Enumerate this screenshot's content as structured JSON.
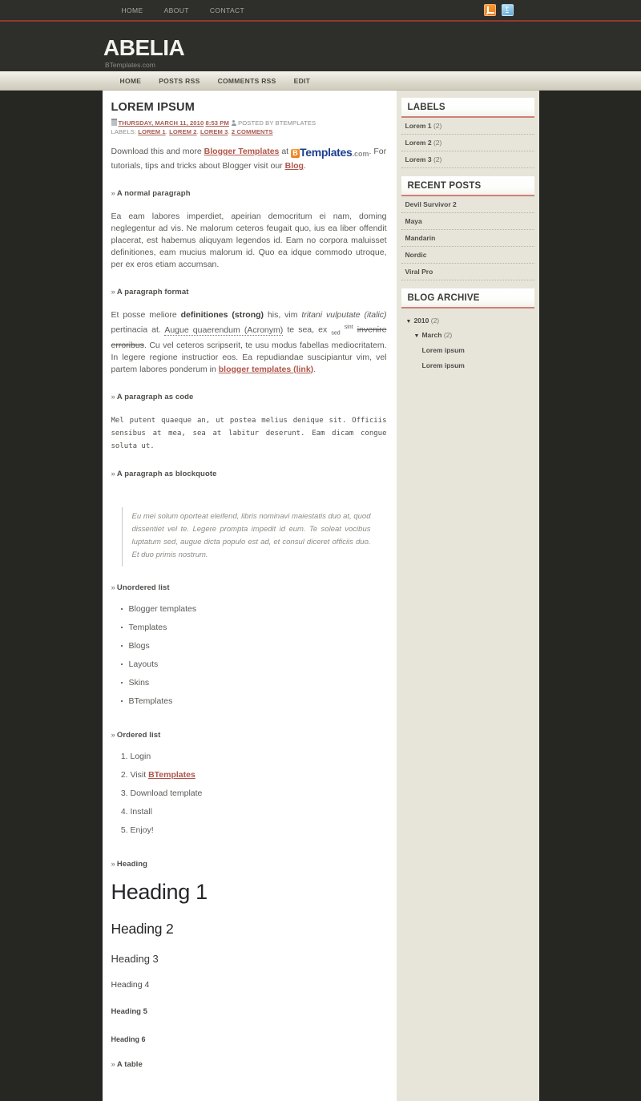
{
  "topbar": {
    "nav": [
      {
        "label": "HOME"
      },
      {
        "label": "ABOUT"
      },
      {
        "label": "CONTACT"
      }
    ],
    "social": [
      {
        "name": "rss-icon",
        "glyph": ""
      },
      {
        "name": "twitter-icon",
        "glyph": "t"
      }
    ]
  },
  "header": {
    "title": "ABELIA",
    "description": "BTemplates.com"
  },
  "menubar": {
    "nav": [
      {
        "label": "HOME"
      },
      {
        "label": "POSTS RSS"
      },
      {
        "label": "COMMENTS RSS"
      },
      {
        "label": "EDIT"
      }
    ]
  },
  "post": {
    "title": "LOREM IPSUM",
    "date": "THURSDAY, MARCH 11, 2010",
    "time": "8:53 PM",
    "author_text": "POSTED BY BTEMPLATES",
    "labels_prefix": "LABELS:",
    "labels": [
      "LOREM 1",
      "LOREM 2",
      "LOREM 3"
    ],
    "label_sep": ".",
    "comments": "2 COMMENTS",
    "intro": {
      "part1": "Download this and more ",
      "link1": "Blogger Templates",
      "part2": " at ",
      "logo_b": "B",
      "logo_word": "Templates",
      "logo_com": ".com",
      "part3": ". For tutorials, tips and tricks about Blogger visit our ",
      "link2": "Blog",
      "part4": "."
    },
    "sections": {
      "normal_paragraph": "A normal paragraph",
      "paragraph_format": "A paragraph format",
      "paragraph_code": "A paragraph as code",
      "paragraph_blockquote": "A paragraph as blockquote",
      "unordered_list": "Unordered list",
      "ordered_list": "Ordered list",
      "heading": "Heading",
      "table": "A table"
    },
    "normal_text": "Ea eam labores imperdiet, apeirian democritum ei nam, doming neglegentur ad vis. Ne malorum ceteros feugait quo, ius ea liber offendit placerat, est habemus aliquyam legendos id. Eam no corpora maluisset definitiones, eam mucius malorum id. Quo ea idque commodo utroque, per ex eros etiam accumsan.",
    "format_text": {
      "t1": "Et posse meliore ",
      "strong": "definitiones (strong)",
      "t2": " his, vim ",
      "italic1": "tritani vulputate",
      "t3": " ",
      "italic2": "(italic)",
      "t4": " pertinacia at. ",
      "acronym": "Augue quaerendum (Acronym)",
      "t5": " te sea, ex ",
      "sub": "sed",
      "t6": " ",
      "sup": "sint",
      "t7": " ",
      "strike": "invenire erroribus",
      "t8": ". Cu vel ceteros scripserit, te usu modus fabellas mediocritatem. In legere regione instructior eos. Ea repudiandae suscipiantur vim, vel partem labores ponderum in ",
      "link": "blogger templates (link)",
      "t9": "."
    },
    "code_text": "Mel putent quaeque an, ut postea melius denique sit. Officiis sensibus at mea, sea at labitur deserunt. Eam dicam congue soluta ut.",
    "blockquote_text": "Eu mei solum oporteat eleifend, libris nominavi maiestatis duo at, quod dissentiet vel te. Legere prompta impedit id eum. Te soleat vocibus luptatum sed, augue dicta populo est ad, et consul diceret officiis duo. Et duo primis nostrum.",
    "unordered_items": [
      "Blogger templates",
      "Templates",
      "Blogs",
      "Layouts",
      "Skins",
      "BTemplates"
    ],
    "ordered_items": [
      {
        "text": "Login",
        "link": ""
      },
      {
        "text": "Visit ",
        "link": "BTemplates"
      },
      {
        "text": "Download template",
        "link": ""
      },
      {
        "text": "Install",
        "link": ""
      },
      {
        "text": "Enjoy!",
        "link": ""
      }
    ],
    "headings": {
      "h1": "Heading 1",
      "h2": "Heading 2",
      "h3": "Heading 3",
      "h4": "Heading 4",
      "h5": "Heading 5",
      "h6": "Heading 6"
    }
  },
  "sidebar": {
    "labels": {
      "title": "LABELS",
      "items": [
        {
          "name": "Lorem 1",
          "count": "(2)"
        },
        {
          "name": "Lorem 2",
          "count": "(2)"
        },
        {
          "name": "Lorem 3",
          "count": "(2)"
        }
      ]
    },
    "recent_posts": {
      "title": "RECENT POSTS",
      "items": [
        {
          "name": "Devil Survivor 2"
        },
        {
          "name": "Maya"
        },
        {
          "name": "Mandarin"
        },
        {
          "name": "Nordic"
        },
        {
          "name": "Viral Pro"
        }
      ]
    },
    "blog_archive": {
      "title": "BLOG ARCHIVE",
      "year": "2010",
      "year_count": "(2)",
      "month": "March",
      "month_count": "(2)",
      "posts": [
        "Lorem ipsum",
        "Lorem ipsum"
      ],
      "triangle": "▼"
    }
  },
  "colors": {
    "accent_red": "#8f3b33",
    "link_red": "#b0554a",
    "header_dark": "#2e2e2a",
    "sidebar_beige": "#e7e5da",
    "page_bg": "#262622"
  }
}
